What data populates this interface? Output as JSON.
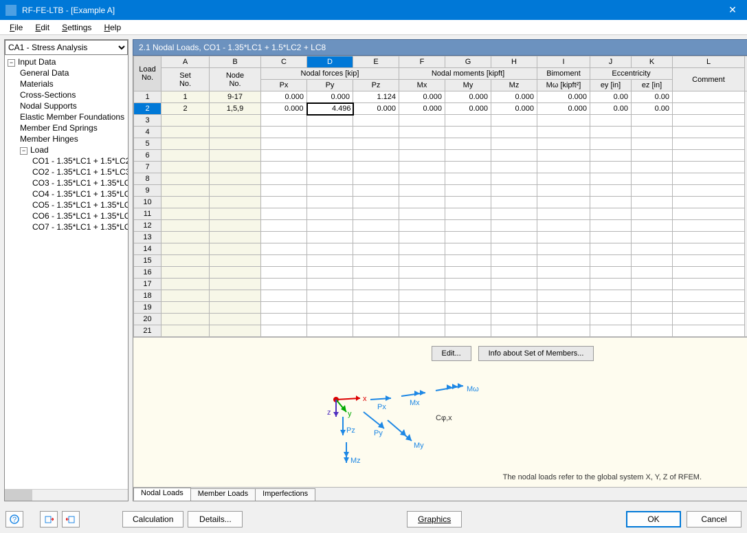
{
  "window": {
    "title": "RF-FE-LTB - [Example A]"
  },
  "menu": {
    "file": "File",
    "edit": "Edit",
    "settings": "Settings",
    "help": "Help"
  },
  "sidebar": {
    "case_selector": "CA1 - Stress Analysis",
    "root": "Input Data",
    "items": [
      "General Data",
      "Materials",
      "Cross-Sections",
      "Nodal Supports",
      "Elastic Member Foundations",
      "Member End Springs",
      "Member Hinges"
    ],
    "load_group": "Load",
    "loads": [
      "CO1 - 1.35*LC1 + 1.5*LC2",
      "CO2 - 1.35*LC1 + 1.5*LC3",
      "CO3 - 1.35*LC1 + 1.35*LC",
      "CO4 - 1.35*LC1 + 1.35*LC",
      "CO5 - 1.35*LC1 + 1.35*LC",
      "CO6 - 1.35*LC1 + 1.35*LC",
      "CO7 - 1.35*LC1 + 1.35*LC"
    ]
  },
  "main": {
    "title": "2.1 Nodal Loads, CO1 - 1.35*LC1 + 1.5*LC2 + LC8",
    "col_letters": [
      "A",
      "B",
      "C",
      "D",
      "E",
      "F",
      "G",
      "H",
      "I",
      "J",
      "K",
      "L"
    ],
    "group_headers": {
      "load_no": "Load\nNo.",
      "set_no": "Set\nNo.",
      "node_no": "Node\nNo.",
      "forces": "Nodal forces  [kip]",
      "moments": "Nodal moments  [kipft]",
      "bimoment": "Bimoment",
      "bimoment_unit": "Mω [kipft²]",
      "eccentricity": "Eccentricity",
      "px": "Px",
      "py": "Py",
      "pz": "Pz",
      "mx": "Mx",
      "my": "My",
      "mz": "Mz",
      "ey": "ey [in]",
      "ez": "ez [in]",
      "comment": "Comment"
    },
    "rows": [
      {
        "no": "1",
        "set": "1",
        "node": "9-17",
        "px": "0.000",
        "py": "0.000",
        "pz": "1.124",
        "mx": "0.000",
        "my": "0.000",
        "mz": "0.000",
        "mw": "0.000",
        "ey": "0.00",
        "ez": "0.00",
        "comment": ""
      },
      {
        "no": "2",
        "set": "2",
        "node": "1,5,9",
        "px": "0.000",
        "py": "4.496",
        "pz": "0.000",
        "mx": "0.000",
        "my": "0.000",
        "mz": "0.000",
        "mw": "0.000",
        "ey": "0.00",
        "ez": "0.00",
        "comment": ""
      }
    ],
    "selected_row": 1,
    "selected_col": "D",
    "editing_value": "4.496",
    "empty_row_count": 21
  },
  "preview": {
    "edit_btn": "Edit...",
    "info_btn": "Info about Set of Members...",
    "note": "The nodal loads refer to the global system X, Y, Z of RFEM.",
    "labels": {
      "x": "x",
      "y": "y",
      "z": "z",
      "px": "Px",
      "py": "Py",
      "pz": "Pz",
      "mx": "Mx",
      "my": "My",
      "mz": "Mz",
      "mw": "Mω",
      "cphi": "Cφ,x"
    }
  },
  "tabs": {
    "t1": "Nodal Loads",
    "t2": "Member Loads",
    "t3": "Imperfections"
  },
  "footer": {
    "calculation": "Calculation",
    "details": "Details...",
    "graphics": "Graphics",
    "ok": "OK",
    "cancel": "Cancel"
  }
}
